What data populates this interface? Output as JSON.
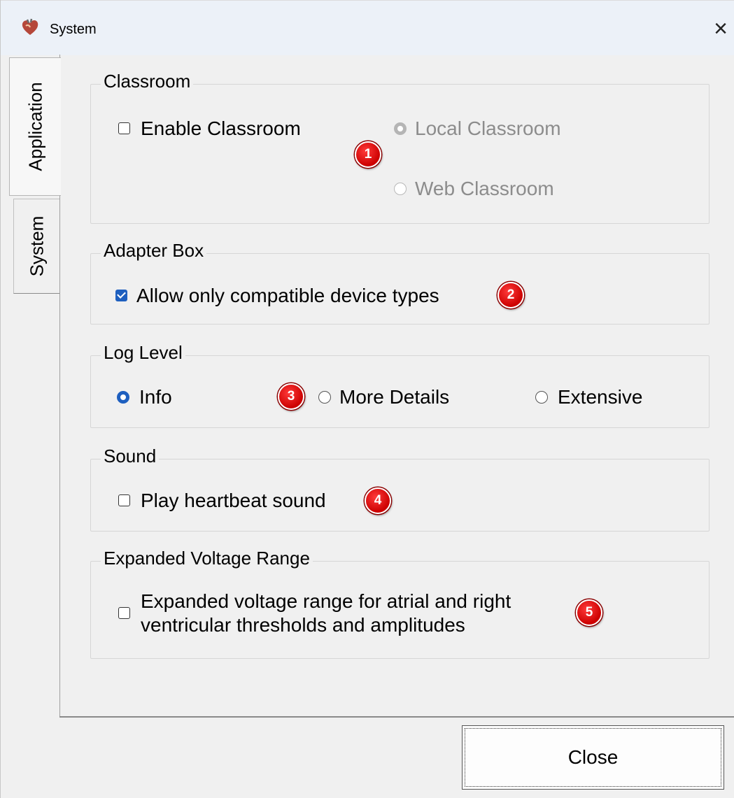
{
  "window": {
    "title": "System",
    "close_icon": "×"
  },
  "tabs": [
    {
      "label": "Application",
      "selected": true
    },
    {
      "label": "System",
      "selected": false
    }
  ],
  "groups": {
    "classroom": {
      "title": "Classroom",
      "enable_checkbox": {
        "label": "Enable Classroom",
        "checked": false
      },
      "local_radio": {
        "label": "Local Classroom",
        "selected": true,
        "enabled": false
      },
      "web_radio": {
        "label": "Web Classroom",
        "selected": false,
        "enabled": false
      }
    },
    "adapter": {
      "title": "Adapter Box",
      "compatible_checkbox": {
        "label": "Allow only compatible device types",
        "checked": true
      }
    },
    "log_level": {
      "title": "Log Level",
      "options": [
        {
          "label": "Info",
          "selected": true
        },
        {
          "label": "More Details",
          "selected": false
        },
        {
          "label": "Extensive",
          "selected": false
        }
      ]
    },
    "sound": {
      "title": "Sound",
      "heartbeat_checkbox": {
        "label": "Play heartbeat sound",
        "checked": false
      }
    },
    "voltage": {
      "title": "Expanded Voltage Range",
      "expanded_checkbox": {
        "label_line1": "Expanded voltage range for atrial and right",
        "label_line2": "ventricular thresholds and amplitudes",
        "checked": false
      }
    }
  },
  "badges": [
    "1",
    "2",
    "3",
    "4",
    "5"
  ],
  "buttons": {
    "close_label": "Close"
  },
  "colors": {
    "accent": "#1e5fbf",
    "badge": "#cc0000",
    "titlebar": "#ecf1f8"
  }
}
